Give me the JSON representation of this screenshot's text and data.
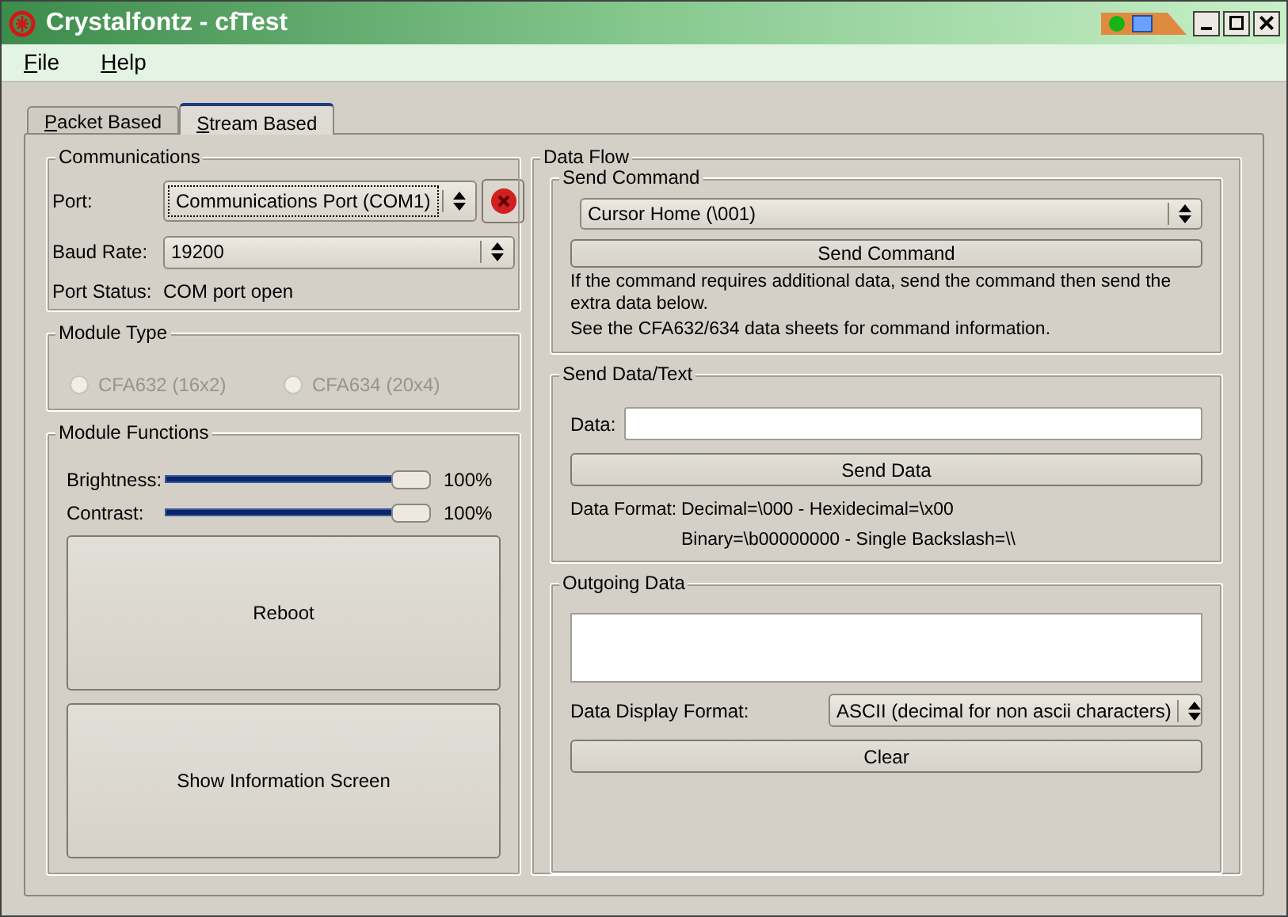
{
  "window": {
    "title": "Crystalfontz - cfTest"
  },
  "menu": [
    "File",
    "Help"
  ],
  "tabs": [
    {
      "label": "Packet Based",
      "selected": false
    },
    {
      "label": "Stream Based",
      "selected": true
    }
  ],
  "communications": {
    "title": "Communications",
    "port_label": "Port:",
    "port_value": "Communications Port (COM1)",
    "baud_label": "Baud Rate:",
    "baud_value": "19200",
    "status_label": "Port Status:",
    "status_value": "COM port open"
  },
  "module_type": {
    "title": "Module Type",
    "options": [
      {
        "label": "CFA632 (16x2)",
        "selected": false,
        "disabled": true
      },
      {
        "label": "CFA634 (20x4)",
        "selected": false,
        "disabled": true
      }
    ]
  },
  "module_functions": {
    "title": "Module Functions",
    "sliders": [
      {
        "label": "Brightness:",
        "level": 1.0,
        "reading": "100%"
      },
      {
        "label": "Contrast:",
        "level": 1.0,
        "reading": "100%"
      }
    ],
    "buttons": [
      "Reboot",
      "Show Information Screen"
    ]
  },
  "data_flow": {
    "title": "Data Flow",
    "send_command": {
      "title": "Send Command",
      "command": "Cursor Home (\\001)",
      "button": "Send Command",
      "notes": [
        "If the command requires additional data, send the command then send the extra data below.",
        "See the CFA632/634 data sheets for command information."
      ]
    },
    "send_data": {
      "title": "Send Data/Text",
      "data_label": "Data:",
      "button": "Send Data",
      "format_label": "Data Format:",
      "format_lines": [
        "Decimal=\\000 - Hexidecimal=\\x00",
        "Binary=\\b00000000 - Single Backslash=\\\\"
      ]
    },
    "outgoing": {
      "title": "Outgoing Data",
      "format_label": "Data Display Format:",
      "format_value": "ASCII (decimal for non ascii characters)",
      "button": "Clear"
    }
  }
}
